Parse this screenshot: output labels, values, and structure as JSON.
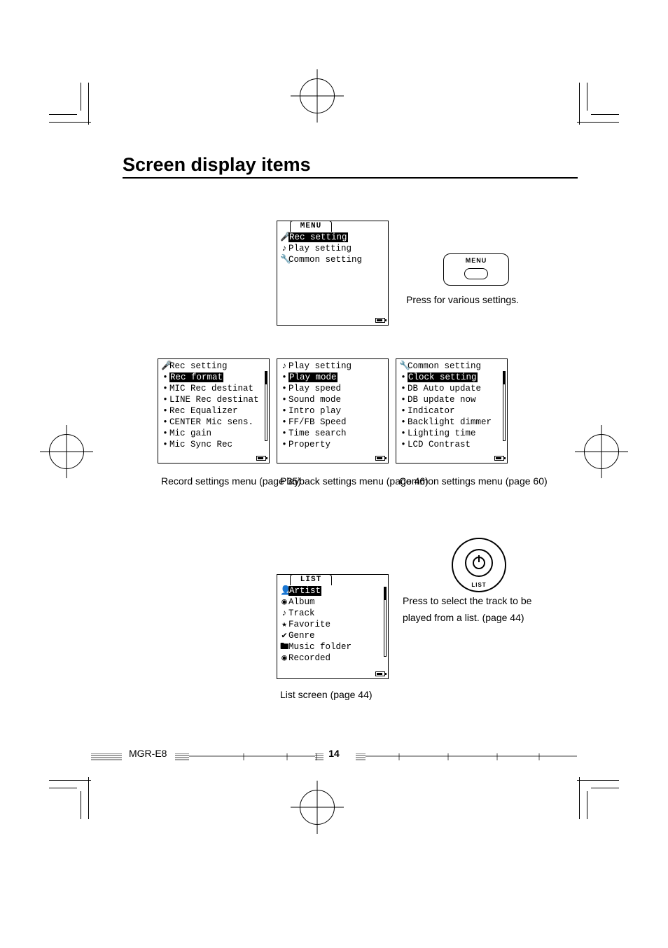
{
  "title": "Screen display items",
  "menu_button": {
    "label": "MENU",
    "caption": "Press for various settings."
  },
  "list_button": {
    "label": "LIST",
    "caption": "Press to select the track to be played from a list. (page 44)"
  },
  "menu_screen": {
    "tab": "MENU",
    "items": [
      {
        "icon": "mic-icon",
        "glyph": "🎤",
        "label": "Rec setting",
        "selected": true
      },
      {
        "icon": "note-icon",
        "glyph": "♪",
        "label": "Play setting",
        "selected": false
      },
      {
        "icon": "wrench-icon",
        "glyph": "🔧",
        "label": "Common setting",
        "selected": false
      }
    ]
  },
  "rec_screen": {
    "header_icon": "mic-icon",
    "header_glyph": "🎤",
    "header": "Rec setting",
    "caption": "Record settings menu (page 35)",
    "items": [
      {
        "label": "Rec format",
        "selected": true
      },
      {
        "label": "MIC Rec destinat",
        "selected": false
      },
      {
        "label": "LINE Rec destinat",
        "selected": false
      },
      {
        "label": "Rec Equalizer",
        "selected": false
      },
      {
        "label": "CENTER Mic sens.",
        "selected": false
      },
      {
        "label": "Mic gain",
        "selected": false
      },
      {
        "label": "Mic Sync Rec",
        "selected": false
      }
    ]
  },
  "play_screen": {
    "header_icon": "note-icon",
    "header_glyph": "♪",
    "header": "Play setting",
    "caption": "Playback settings menu (page 46)",
    "items": [
      {
        "label": "Play mode",
        "selected": true
      },
      {
        "label": "Play speed",
        "selected": false
      },
      {
        "label": "Sound mode",
        "selected": false
      },
      {
        "label": "Intro play",
        "selected": false
      },
      {
        "label": "FF/FB Speed",
        "selected": false
      },
      {
        "label": "Time search",
        "selected": false
      },
      {
        "label": "Property",
        "selected": false
      }
    ]
  },
  "common_screen": {
    "header_icon": "wrench-icon",
    "header_glyph": "🔧",
    "header": "Common setting",
    "caption": "Common settings menu (page 60)",
    "items": [
      {
        "label": "Clock setting",
        "selected": true
      },
      {
        "label": "DB Auto update",
        "selected": false
      },
      {
        "label": "DB update now",
        "selected": false
      },
      {
        "label": "Indicator",
        "selected": false
      },
      {
        "label": "Backlight dimmer",
        "selected": false
      },
      {
        "label": "Lighting time",
        "selected": false
      },
      {
        "label": "LCD Contrast",
        "selected": false
      }
    ]
  },
  "list_screen": {
    "tab": "LIST",
    "caption": "List screen  (page 44)",
    "items": [
      {
        "icon": "person-icon",
        "glyph": "👤",
        "label": "Artist",
        "selected": true
      },
      {
        "icon": "disc-icon",
        "glyph": "◉",
        "label": "Album",
        "selected": false
      },
      {
        "icon": "note-icon",
        "glyph": "♪",
        "label": "Track",
        "selected": false
      },
      {
        "icon": "star-icon",
        "glyph": "★",
        "label": "Favorite",
        "selected": false
      },
      {
        "icon": "tag-icon",
        "glyph": "✔",
        "label": "Genre",
        "selected": false
      },
      {
        "icon": "folder-icon",
        "glyph": "🖿",
        "label": "Music folder",
        "selected": false
      },
      {
        "icon": "record-icon",
        "glyph": "◉",
        "label": "Recorded",
        "selected": false
      }
    ]
  },
  "footer": {
    "model": "MGR-E8",
    "page": "14"
  }
}
